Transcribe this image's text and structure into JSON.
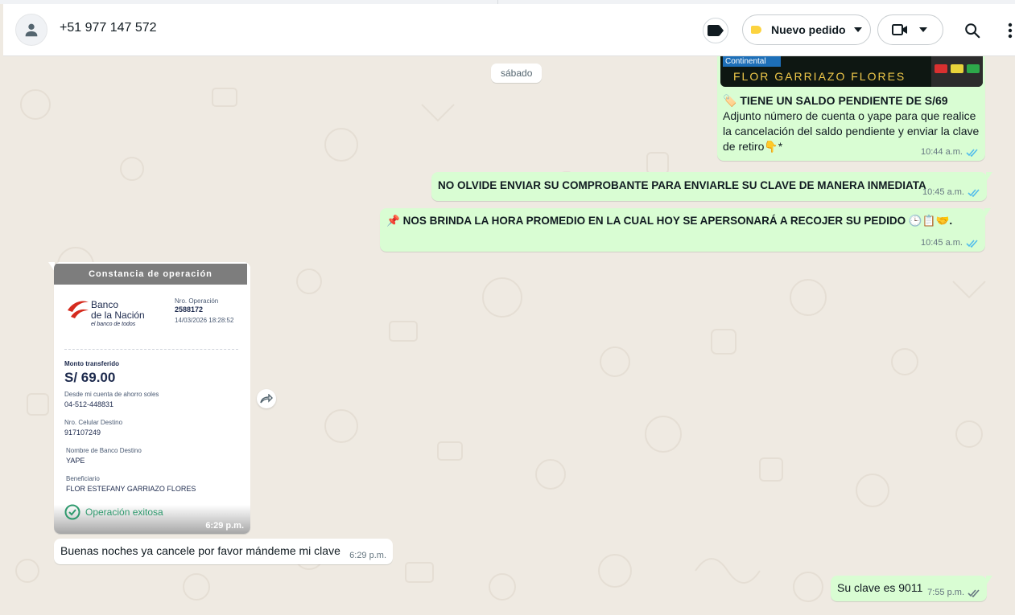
{
  "header": {
    "contact_phone": "+51 977 147 572",
    "order_label": "Nuevo pedido",
    "icons": [
      "person-icon",
      "label-icon",
      "video-icon",
      "chevron-down-icon",
      "search-icon",
      "more-vert-icon"
    ]
  },
  "chat": {
    "day_label": "sábado",
    "messages": [
      {
        "direction": "outgoing",
        "image_banner_brand": "Continental",
        "image_banner_name": "FLOR GARRIAZO FLORES",
        "headline": "TIENE UN SALDO PENDIENTE DE S/69",
        "body": " Adjunto número de cuenta o yape para que realice la cancelación del saldo pendiente y enviar la clave de retiro",
        "suffix": "*",
        "time": "10:44 a.m.",
        "status": "read"
      },
      {
        "direction": "outgoing",
        "text": "NO OLVIDE ENVIAR SU COMPROBANTE PARA ENVIARLE SU CLAVE DE MANERA INMEDIATA",
        "time": "10:45 a.m.",
        "status": "read"
      },
      {
        "direction": "outgoing",
        "text": "NOS BRINDA LA HORA PROMEDIO EN LA CUAL HOY SE APERSONARÁ A RECOJER SU PEDIDO",
        "suffix": ".",
        "time": "10:45 a.m.",
        "status": "read"
      },
      {
        "direction": "incoming",
        "type": "image",
        "time": "6:29 p.m.",
        "receipt": {
          "title": "Constancia de operación",
          "bank_line1": "Banco",
          "bank_line2": "de la Nación",
          "slogan": "el banco de todos",
          "op_label": "Nro. Operación",
          "op_number": "2588172",
          "op_datetime": "14/03/2026 18:28:52",
          "amount_label": "Monto transferido",
          "amount": "S/ 69.00",
          "fields": [
            {
              "label": "Desde mi cuenta de ahorro soles",
              "value": "04-512-448831"
            },
            {
              "label": "Nro. Celular Destino",
              "value": "917107249"
            },
            {
              "label": "Nombre de Banco Destino",
              "value": "YAPE"
            },
            {
              "label": "Beneficiario",
              "value": "FLOR ESTEFANY GARRIAZO FLORES"
            }
          ],
          "status": "Operación exitosa"
        }
      },
      {
        "direction": "incoming",
        "text": "Buenas noches ya cancele por favor mándeme mi clave",
        "time": "6:29 p.m."
      },
      {
        "direction": "outgoing",
        "text": "Su clave es 9011",
        "time": "7:55 p.m.",
        "status": "delivered"
      }
    ]
  },
  "colors": {
    "outgoing_bubble": "#d9fdd3",
    "incoming_bubble": "#ffffff",
    "chat_background": "#efeae2",
    "read_ticks": "#53bdeb",
    "label_yellow": "#fcd33f",
    "success_green": "#2f9a6e"
  }
}
